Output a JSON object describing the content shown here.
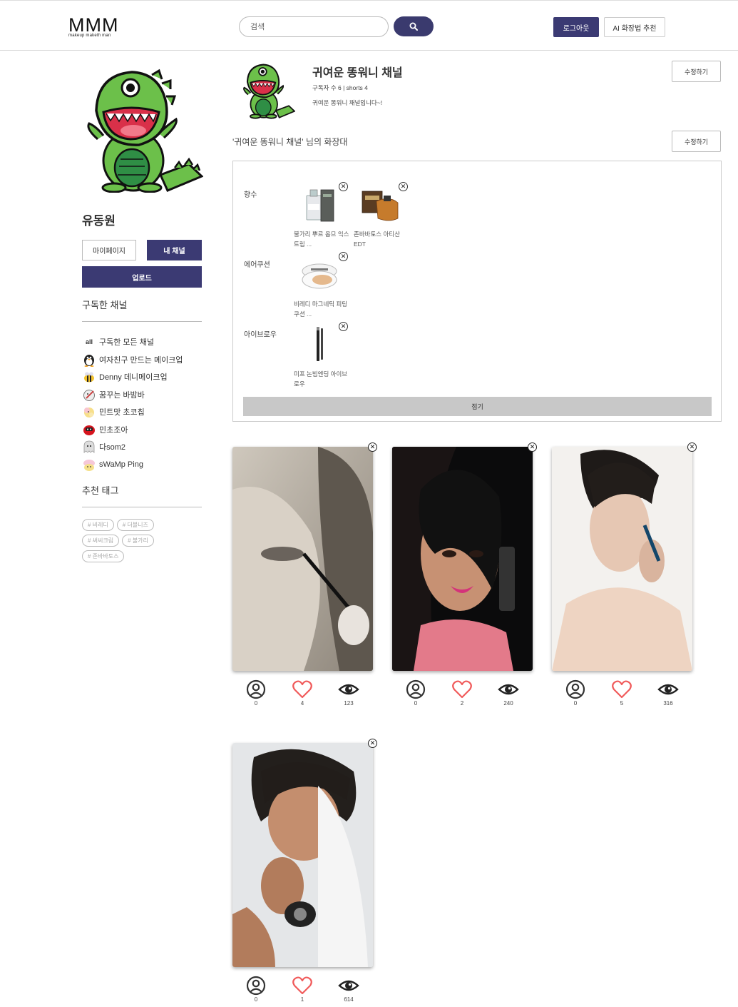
{
  "header": {
    "logo": "MMM",
    "logo_sub": "makeup maketh man",
    "search_placeholder": "검색",
    "logout_label": "로그아웃",
    "ai_label": "AI 화장법 추천"
  },
  "sidebar": {
    "user_name": "유동원",
    "mypage_label": "마이페이지",
    "mychannel_label": "내 채널",
    "upload_label": "업로드",
    "subscribed_title": "구독한 채널",
    "subscriptions": [
      {
        "icon_text": "all",
        "label": "구독한 모든 채널"
      },
      {
        "icon_text": "",
        "label": "여자친구 만드는 메이크업"
      },
      {
        "icon_text": "",
        "label": "Denny 데니메이크업"
      },
      {
        "icon_text": "",
        "label": "꿈꾸는 바밤바"
      },
      {
        "icon_text": "",
        "label": "민트맛 초코칩"
      },
      {
        "icon_text": "",
        "label": "민초조아"
      },
      {
        "icon_text": "",
        "label": "다som2"
      },
      {
        "icon_text": "",
        "label": "sWaMp Ping"
      }
    ],
    "tags_title": "추천 태그",
    "tags": [
      "# 비레디",
      "# 더블니즈",
      "# 써씨크림",
      "# 불가리",
      "# 존바바토스"
    ]
  },
  "channel": {
    "title": "귀여운 똥워니 채널",
    "stats": "구독자 수 6 | shorts 4",
    "description": "귀여운 똥워니 채널입니다~!",
    "edit_label": "수정하기",
    "vanity_title": "'귀여운 똥워니 채널' 님의 화장대",
    "vanity_edit_label": "수정하기",
    "fold_label": "접기"
  },
  "vanity": {
    "categories": [
      {
        "name": "향수",
        "products": [
          "불가리 뿌르 옴므 익스트림 ...",
          "존바바토스 아티산 EDT"
        ]
      },
      {
        "name": "에어쿠션",
        "products": [
          "비레디 마그네틱 피팅 쿠션 ..."
        ]
      },
      {
        "name": "아이브로우",
        "products": [
          "미프 논빔엔딩 아이브로우"
        ]
      }
    ]
  },
  "shorts": [
    {
      "subscribers": "0",
      "likes": "4",
      "views": "123"
    },
    {
      "subscribers": "0",
      "likes": "2",
      "views": "240"
    },
    {
      "subscribers": "0",
      "likes": "5",
      "views": "316"
    },
    {
      "subscribers": "0",
      "likes": "1",
      "views": "614"
    }
  ],
  "colors": {
    "primary": "#3b3a73",
    "heart": "#f05a5a",
    "fold": "#c8c8c8"
  }
}
